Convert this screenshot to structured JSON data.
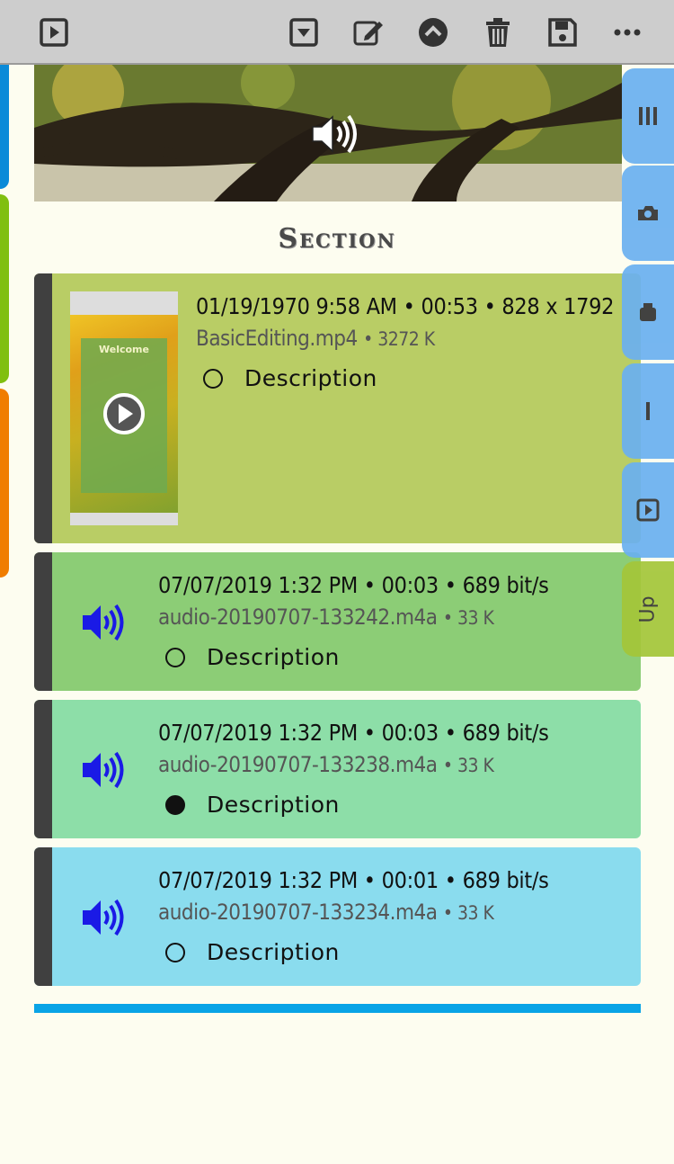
{
  "toolbar": {
    "icons": [
      "play-square-icon",
      "dropdown-square-icon",
      "edit-icon",
      "up-circle-icon",
      "trash-icon",
      "save-icon",
      "more-icon"
    ]
  },
  "section": {
    "title": "Section"
  },
  "right_tabs": {
    "icons": [
      "columns-icon",
      "camera-icon",
      "video-camera-icon",
      "text-cursor-icon",
      "play-icon"
    ],
    "up_label": "Up"
  },
  "cards": [
    {
      "meta": "01/19/1970  9:58 AM • 00:53 • 828 x 1792",
      "file": "BasicEditing.mp4",
      "size": "• 3272 K",
      "description": "Description",
      "selected": false,
      "color": "#b9cd65",
      "thumb_title": "Welcome"
    },
    {
      "meta": "07/07/2019  1:32 PM • 00:03 • 689 bit/s",
      "file": "audio-20190707-133242.m4a",
      "size": "• 33 K",
      "description": "Description",
      "selected": false,
      "color": "#8ccd76"
    },
    {
      "meta": "07/07/2019  1:32 PM • 00:03 • 689 bit/s",
      "file": "audio-20190707-133238.m4a",
      "size": "• 33 K",
      "description": "Description",
      "selected": true,
      "color": "#8ddea8"
    },
    {
      "meta": "07/07/2019  1:32 PM • 00:01 • 689 bit/s",
      "file": "audio-20190707-133234.m4a",
      "size": "• 33 K",
      "description": "Description",
      "selected": false,
      "color": "#8adcee"
    }
  ],
  "colors": {
    "accent": "#0aa4e6",
    "speaker": "#1a1ae6",
    "left_tabs": [
      "#0a8ad8",
      "#80bf10",
      "#f07d00"
    ],
    "right_tab": "#6ab0f0",
    "up_tab": "#a4c639"
  }
}
